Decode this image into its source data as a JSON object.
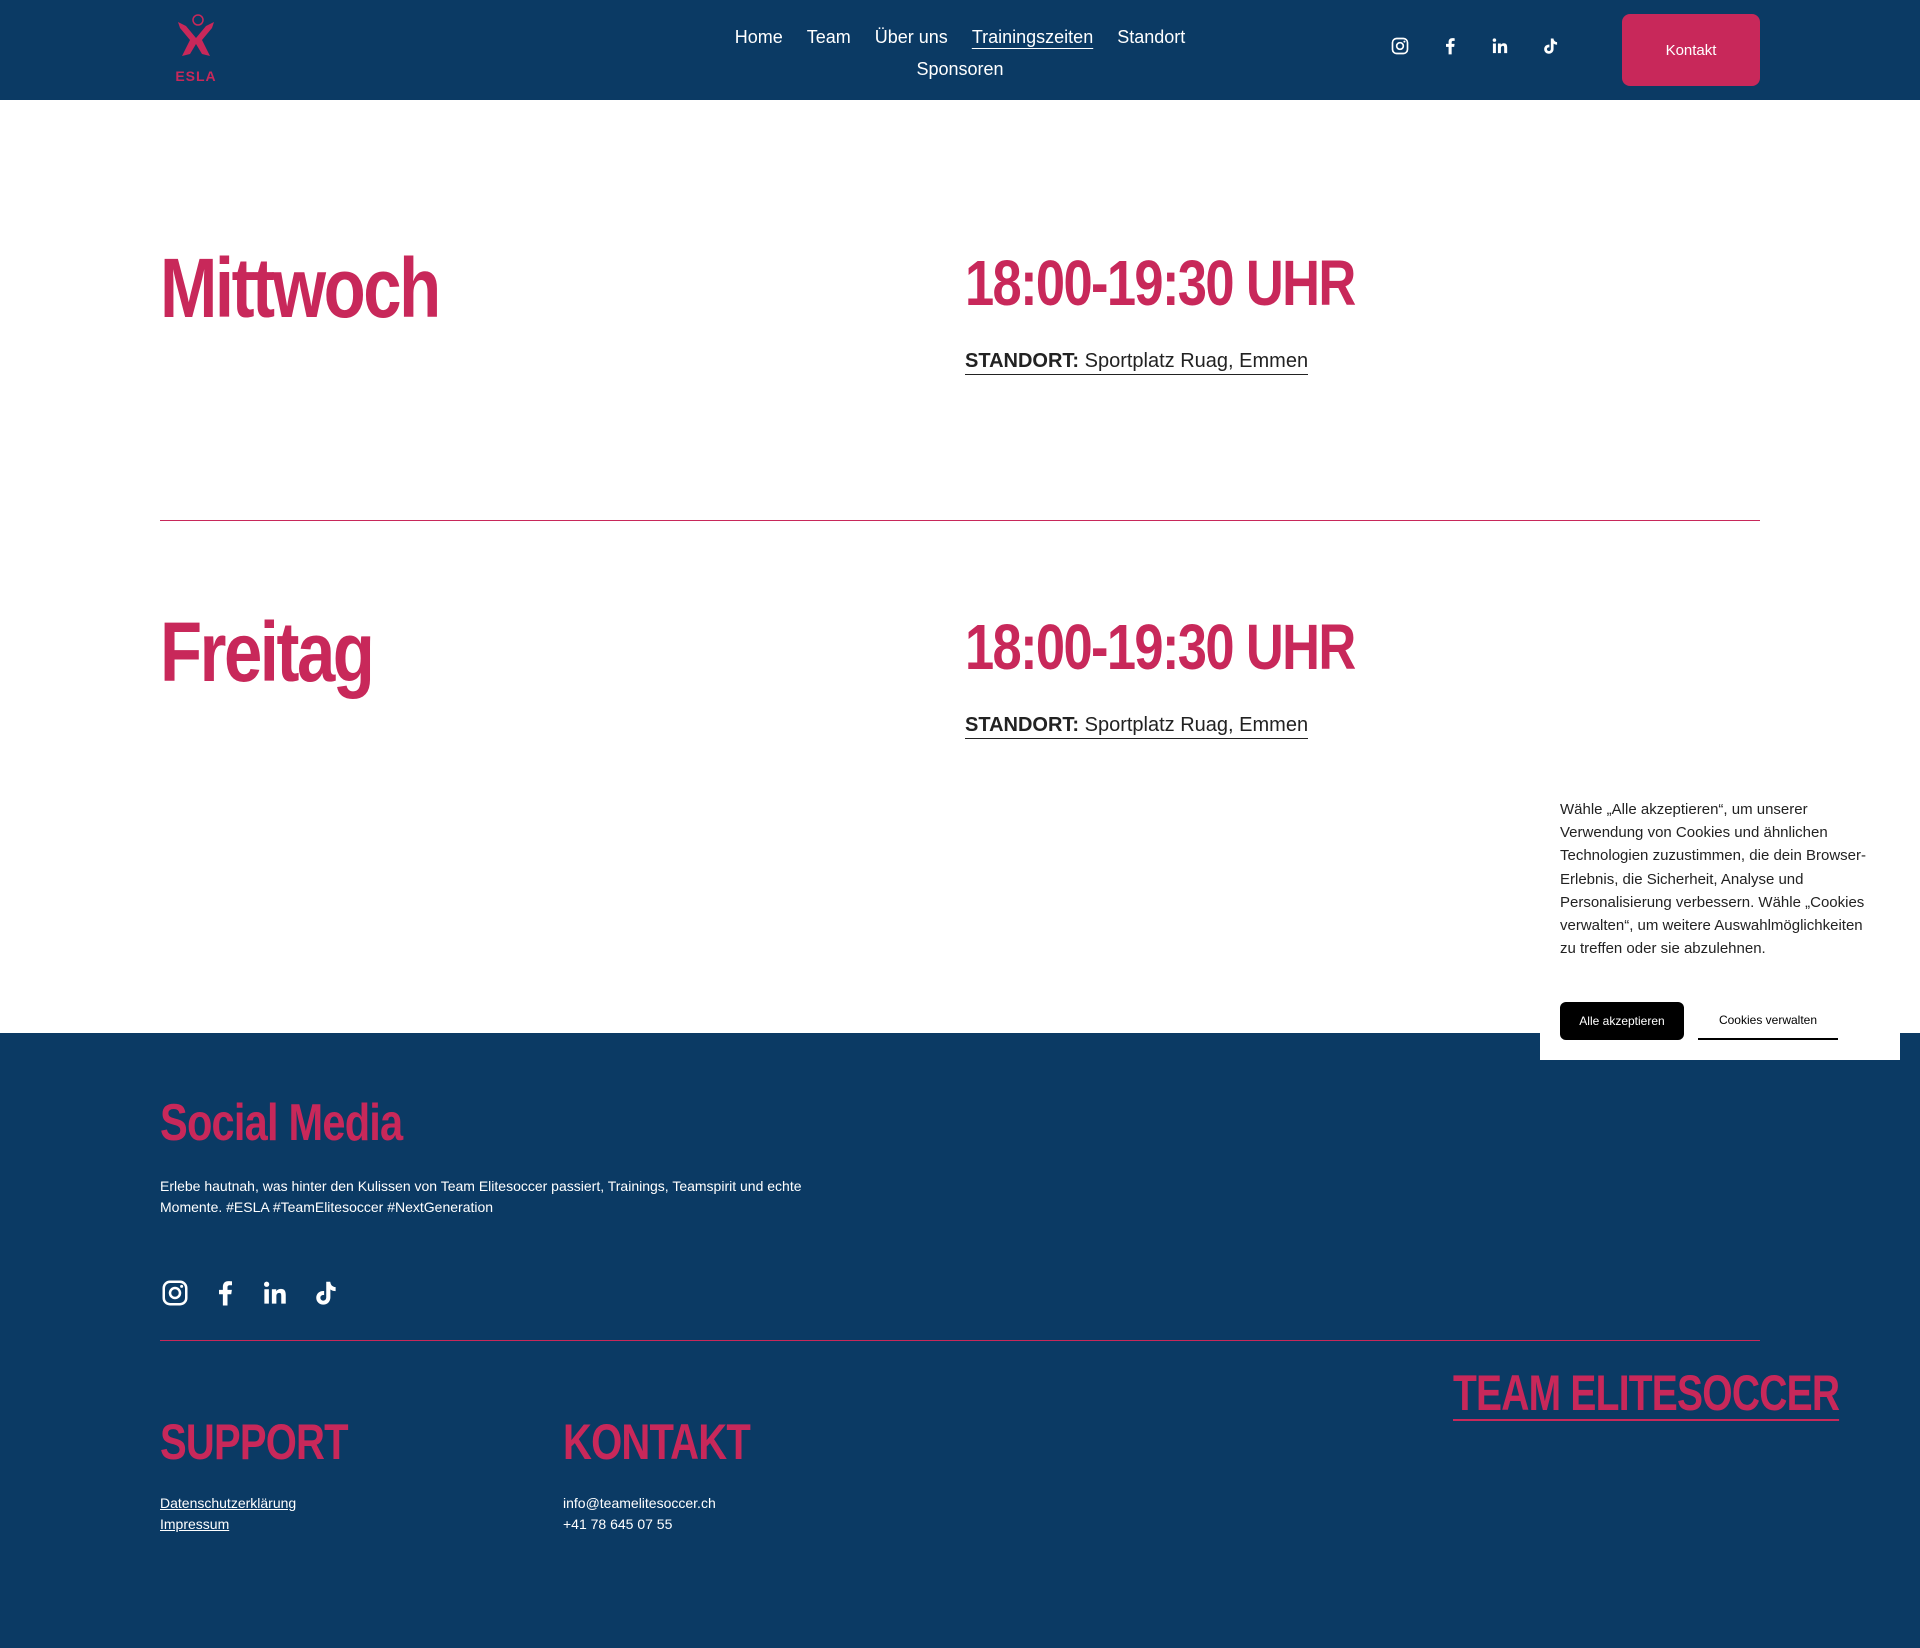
{
  "header": {
    "logo_text": "ESLA",
    "nav": [
      "Home",
      "Team",
      "Über uns",
      "Trainingszeiten",
      "Standort",
      "Sponsoren"
    ],
    "active_nav": "Trainingszeiten",
    "social_icons": [
      "instagram-icon",
      "facebook-icon",
      "linkedin-icon",
      "tiktok-icon"
    ],
    "contact_label": "Kontakt"
  },
  "schedule": [
    {
      "day": "Mittwoch",
      "time": "18:00-19:30 UHR",
      "location_label": "STANDORT:",
      "location_value": "Sportplatz Ruag, Emmen"
    },
    {
      "day": "Freitag",
      "time": "18:00-19:30 UHR",
      "location_label": "STANDORT:",
      "location_value": "Sportplatz Ruag, Emmen"
    }
  ],
  "cookie": {
    "text": "Wähle „Alle akzeptieren“, um unserer Verwendung von Cookies und ähnlichen Technologien zuzustimmen, die dein Browser-Erlebnis, die Sicherheit, Analyse und Personalisierung verbessern. Wähle „Cookies verwalten“, um weitere Auswahlmöglichkeiten zu treffen oder sie abzulehnen.",
    "accept_label": "Alle akzeptieren",
    "manage_label": "Cookies verwalten"
  },
  "footer": {
    "social_heading": "Social Media",
    "social_text": "Erlebe hautnah, was hinter den Kulissen von Team Elitesoccer passiert, Trainings, Teamspirit und echte Momente. #ESLA #TeamElitesoccer #NextGeneration",
    "support_heading": "SUPPORT",
    "support_links": [
      "Datenschutzerklärung",
      "Impressum"
    ],
    "contact_heading": "KONTAKT",
    "email": "info@teamelitesoccer.ch",
    "phone": "+41 78 645 07 55",
    "brand": "TEAM ELITESOCCER"
  },
  "colors": {
    "navy": "#0b3a64",
    "accent": "#c8285a",
    "white": "#ffffff"
  }
}
